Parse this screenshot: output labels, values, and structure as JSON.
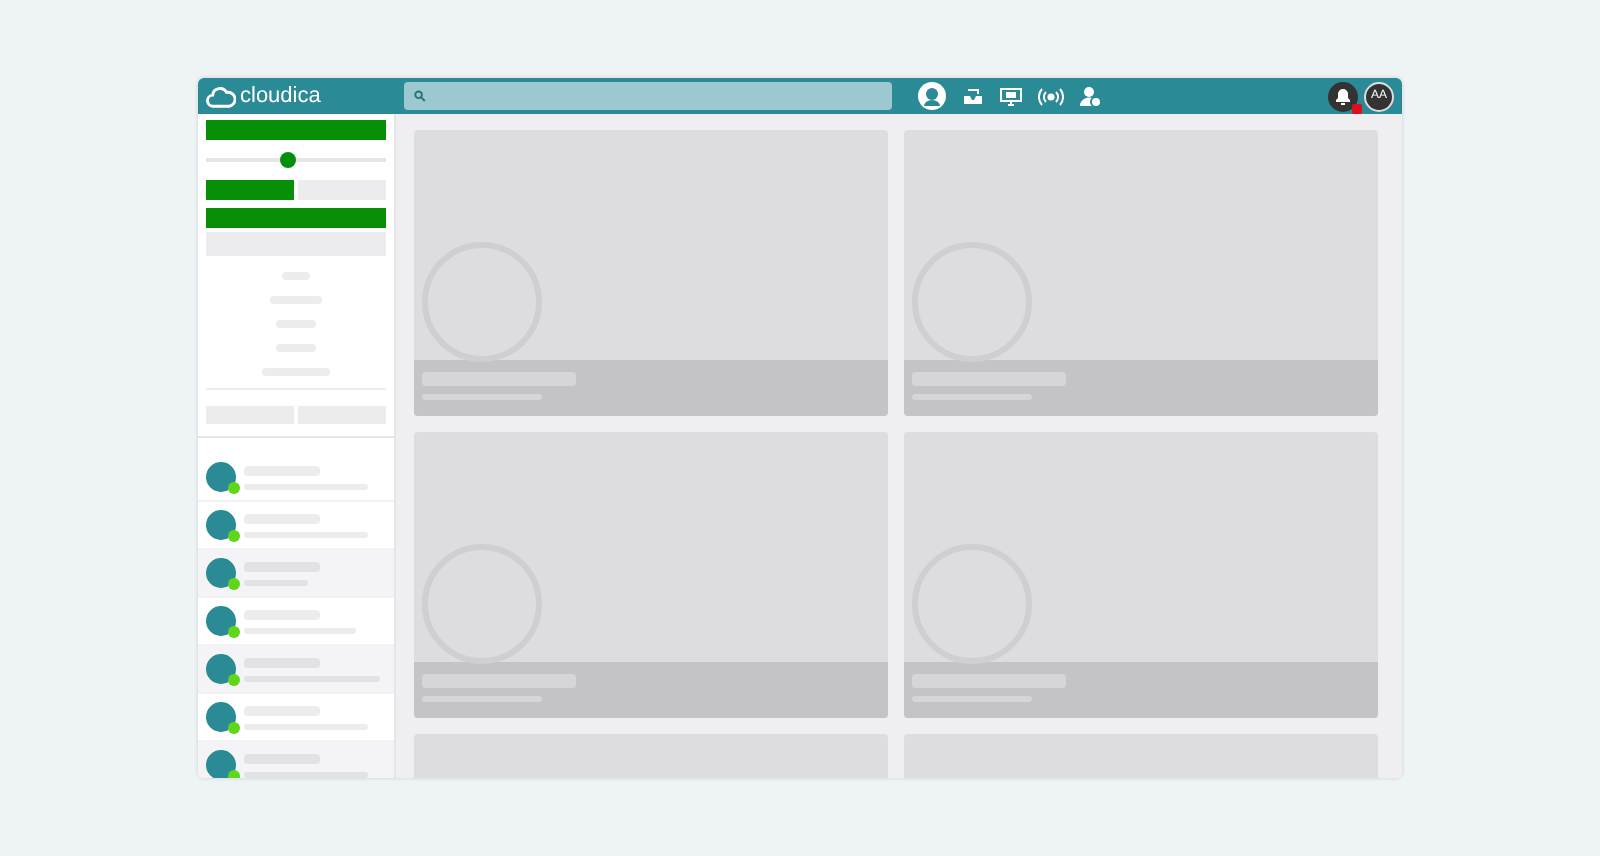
{
  "header": {
    "logo_text": "cloudica",
    "notifications": {
      "unread": true
    },
    "avatar": {
      "initials": "AA"
    }
  },
  "sidebar": {
    "slider": {
      "level": 0.46
    },
    "toggle": [
      {
        "selected": true
      },
      {
        "selected": false
      }
    ],
    "contacts": [
      {
        "color": "#5fd61a"
      },
      {
        "color": "#5fd61a"
      },
      {
        "color": "#5fd61a"
      },
      {
        "color": "#5fd61a"
      },
      {
        "color": "#5fd61a"
      },
      {
        "color": "#5fd61a"
      },
      {
        "color": "#5fd61a"
      }
    ]
  },
  "cards": [
    {
      "kind": "skeleton"
    },
    {
      "kind": "skeleton"
    },
    {
      "kind": "skeleton"
    },
    {
      "kind": "skeleton"
    },
    {
      "kind": "skeleton"
    },
    {
      "kind": "skeleton"
    }
  ]
}
